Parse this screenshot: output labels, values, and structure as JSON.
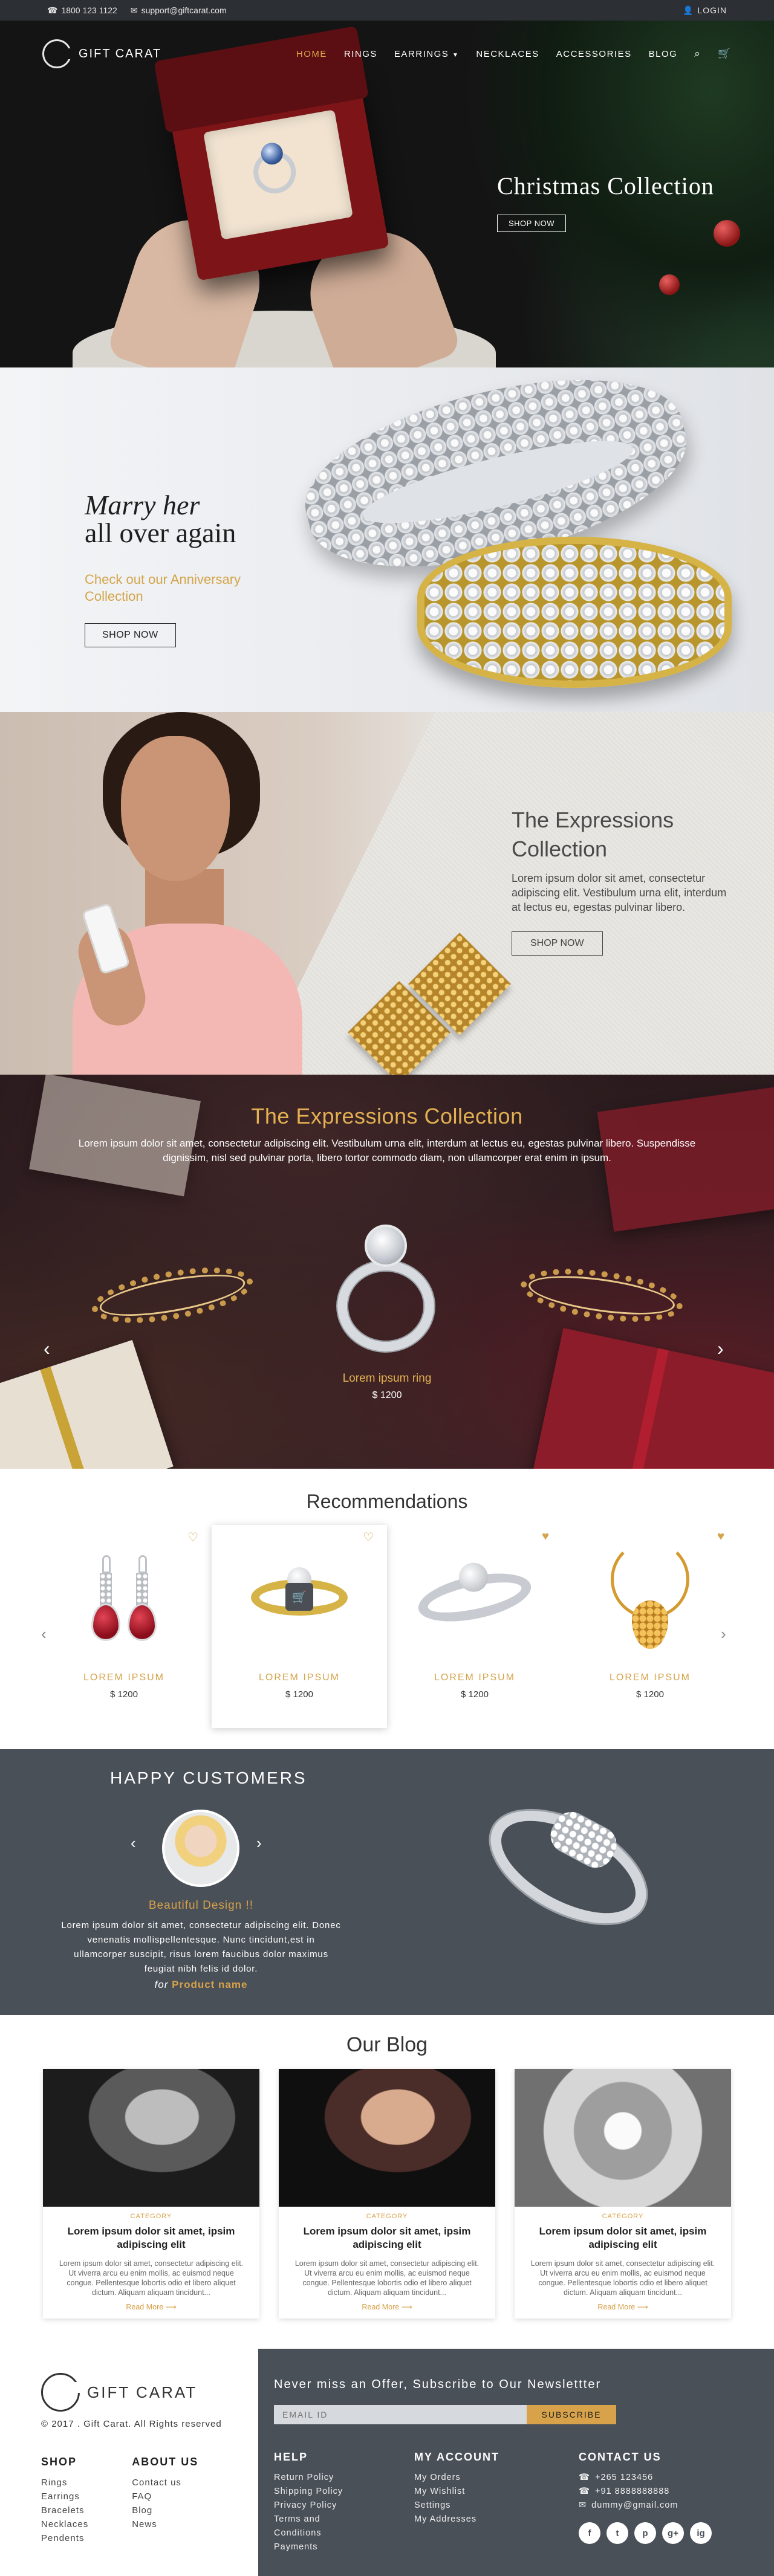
{
  "topbar": {
    "phone": "1800 123 1122",
    "email": "support@giftcarat.com",
    "login": "LOGIN"
  },
  "nav": {
    "logo": "GIFT CARAT",
    "items": [
      "HOME",
      "RINGS",
      "EARRINGS",
      "NECKLACES",
      "ACCESSORIES",
      "BLOG"
    ]
  },
  "hero": {
    "title": "Christmas Collection",
    "button": "SHOP NOW"
  },
  "marry": {
    "title_line1": "Marry her",
    "title_line2": "all over again",
    "subtitle": "Check out our Anniversary Collection",
    "button": "SHOP NOW"
  },
  "expressions_banner": {
    "title": "The Expressions Collection",
    "description": "Lorem ipsum dolor sit amet, consectetur adipiscing elit. Vestibulum urna elit, interdum at lectus eu, egestas pulvinar libero.",
    "button": "SHOP NOW"
  },
  "collection": {
    "title": "The Expressions Collection",
    "description": "Lorem ipsum dolor sit amet, consectetur adipiscing elit. Vestibulum urna elit, interdum at lectus eu, egestas pulvinar libero. Suspendisse dignissim, nisl sed pulvinar porta, libero tortor commodo diam, non ullamcorper erat enim in ipsum.",
    "item_name": "Lorem ipsum ring",
    "item_price": "$ 1200"
  },
  "recommendations": {
    "title": "Recommendations",
    "items": [
      {
        "name": "LOREM IPSUM",
        "price": "$ 1200"
      },
      {
        "name": "LOREM IPSUM",
        "price": "$ 1200"
      },
      {
        "name": "LOREM IPSUM",
        "price": "$ 1200"
      },
      {
        "name": "LOREM IPSUM",
        "price": "$ 1200"
      }
    ]
  },
  "testimonials": {
    "title": "HAPPY CUSTOMERS",
    "name": "Beautiful Design !!",
    "quote": "Lorem ipsum dolor sit amet, consectetur adipiscing elit. Donec venenatis mollispellentesque. Nunc tincidunt,est in ullamcorper suscipit, risus lorem faucibus dolor maximus feugiat nibh felis id dolor.",
    "for_label": "for",
    "product": "Product name"
  },
  "blog": {
    "title": "Our Blog",
    "posts": [
      {
        "category": "CATEGORY",
        "title": "Lorem ipsum dolor sit amet, ipsim adipiscing elit",
        "excerpt": "Lorem ipsum dolor sit amet, consectetur adipiscing elit. Ut viverra arcu eu enim mollis, ac euismod neque congue. Pellentesque lobortis odio et libero aliquet dictum. Aliquam aliquam tincidunt...",
        "more": "Read More ⟶"
      },
      {
        "category": "CATEGORY",
        "title": "Lorem ipsum dolor sit amet, ipsim adipiscing elit",
        "excerpt": "Lorem ipsum dolor sit amet, consectetur adipiscing elit. Ut viverra arcu eu enim mollis, ac euismod neque congue. Pellentesque lobortis odio et libero aliquet dictum. Aliquam aliquam tincidunt...",
        "more": "Read More ⟶"
      },
      {
        "category": "CATEGORY",
        "title": "Lorem ipsum dolor sit amet, ipsim adipiscing elit",
        "excerpt": "Lorem ipsum dolor sit amet, consectetur adipiscing elit. Ut viverra arcu eu enim mollis, ac euismod neque congue. Pellentesque lobortis odio et libero aliquet dictum. Aliquam aliquam tincidunt...",
        "more": "Read More ⟶"
      }
    ]
  },
  "footer": {
    "logo": "GIFT CARAT",
    "copyright": "© 2017 . Gift Carat. All Rights reserved",
    "shop": {
      "title": "SHOP",
      "items": [
        "Rings",
        "Earrings",
        "Bracelets",
        "Necklaces",
        "Pendents"
      ]
    },
    "about": {
      "title": "ABOUT US",
      "items": [
        "Contact us",
        "FAQ",
        "Blog",
        "News"
      ]
    },
    "newsletter_title": "Never miss an Offer, Subscribe to Our Newslettter",
    "email_placeholder": "EMAIL ID",
    "subscribe": "SUBSCRIBE",
    "help": {
      "title": "HELP",
      "items": [
        "Return Policy",
        "Shipping Policy",
        "Privacy Policy",
        "Terms and Conditions",
        "Payments"
      ]
    },
    "account": {
      "title": "MY ACCOUNT",
      "items": [
        "My Orders",
        "My Wishlist",
        "Settings",
        "My Addresses"
      ]
    },
    "contact": {
      "title": "CONTACT US",
      "phone1": "+265 123456",
      "phone2": "+91 8888888888",
      "email": "dummy@gmail.com"
    },
    "socials": [
      "f",
      "t",
      "p",
      "g+",
      "ig"
    ]
  },
  "colors": {
    "accent": "#d8a24a",
    "dark": "#4a5058",
    "topbar": "#2c2f33"
  }
}
